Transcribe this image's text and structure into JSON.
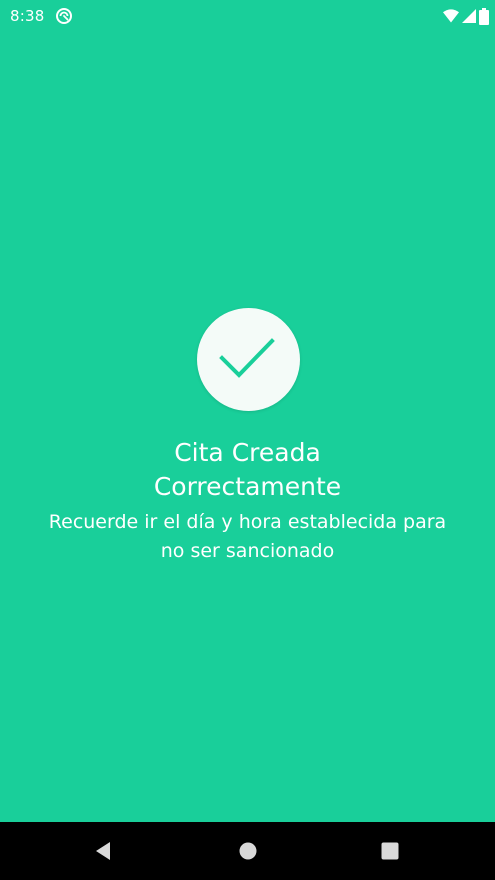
{
  "status_bar": {
    "time": "8:38",
    "app_icon": "notification-app-icon",
    "icons": [
      "wifi-icon",
      "signal-icon",
      "battery-icon"
    ]
  },
  "main": {
    "icon": "checkmark-icon",
    "title_line1": "Cita Creada",
    "title_line2": "Correctamente",
    "message_line1": "Recuerde ir el día y hora establecida para",
    "message_line2": "no ser sancionado"
  },
  "nav_bar": {
    "buttons": [
      "back-icon",
      "home-icon",
      "recents-icon"
    ]
  },
  "colors": {
    "background": "#19CF9A",
    "circle": "#F4FBF8",
    "check": "#19CF9A",
    "text": "#FFFFFF",
    "nav_bar": "#000000"
  }
}
